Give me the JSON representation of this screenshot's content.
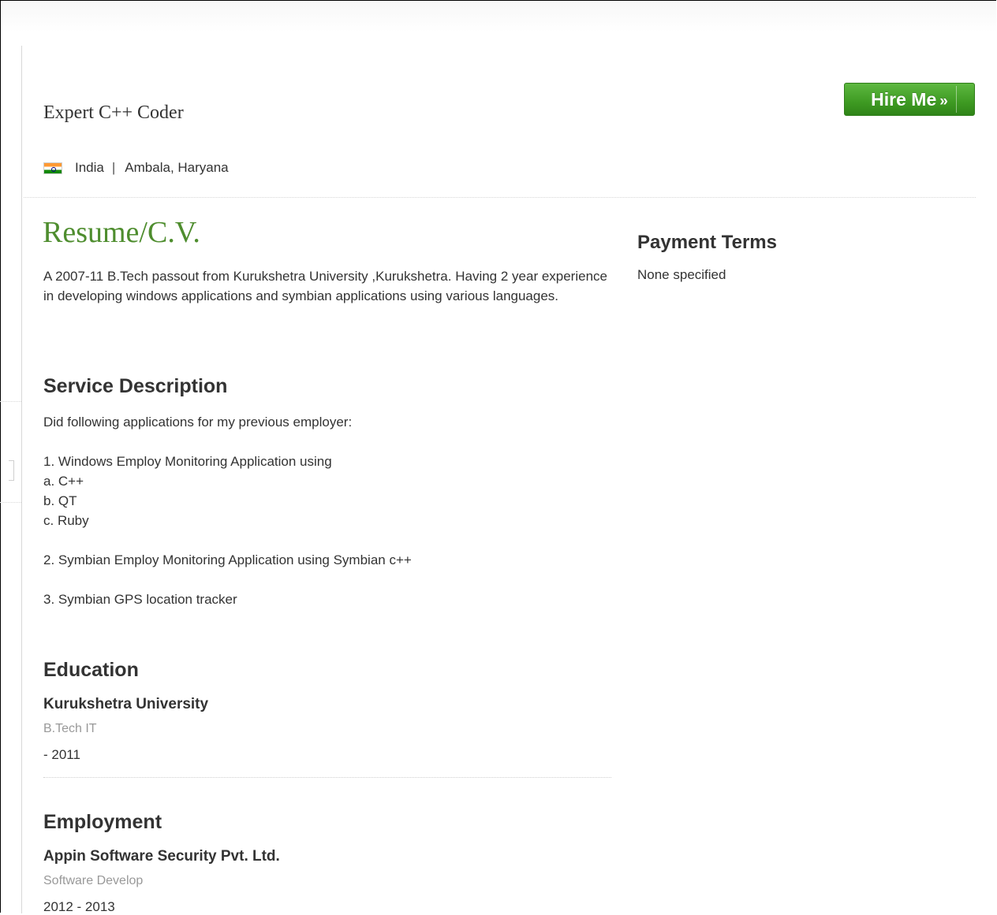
{
  "profile": {
    "title": "Expert C++ Coder",
    "country": "India",
    "separator": "|",
    "city": "Ambala, Haryana",
    "flag_icon": "india-flag-icon"
  },
  "actions": {
    "hire_label": "Hire Me",
    "hire_suffix": "»",
    "hire_color": "#3e9a22"
  },
  "resume": {
    "heading": "Resume/C.V.",
    "heading_color": "#4e8d2e",
    "text": "A 2007-11 B.Tech passout from Kurukshetra University ,Kurukshetra. Having 2 year experience in developing windows applications and symbian applications using various languages."
  },
  "payment": {
    "heading": "Payment Terms",
    "text": "None specified"
  },
  "service": {
    "heading": "Service Description",
    "lines": [
      "Did following applications for my previous employer:",
      "",
      "1. Windows Employ Monitoring Application using",
      "a. C++",
      "b. QT",
      "c. Ruby",
      "",
      "2. Symbian Employ Monitoring Application using Symbian c++",
      "",
      "3. Symbian GPS location tracker"
    ]
  },
  "education": {
    "heading": "Education",
    "entries": [
      {
        "institution": "Kurukshetra University",
        "degree": "B.Tech IT",
        "dates": "- 2011"
      }
    ]
  },
  "employment": {
    "heading": "Employment",
    "entries": [
      {
        "company": "Appin Software Security Pvt. Ltd.",
        "role": "Software Develop",
        "dates": "2012 - 2013"
      }
    ]
  }
}
